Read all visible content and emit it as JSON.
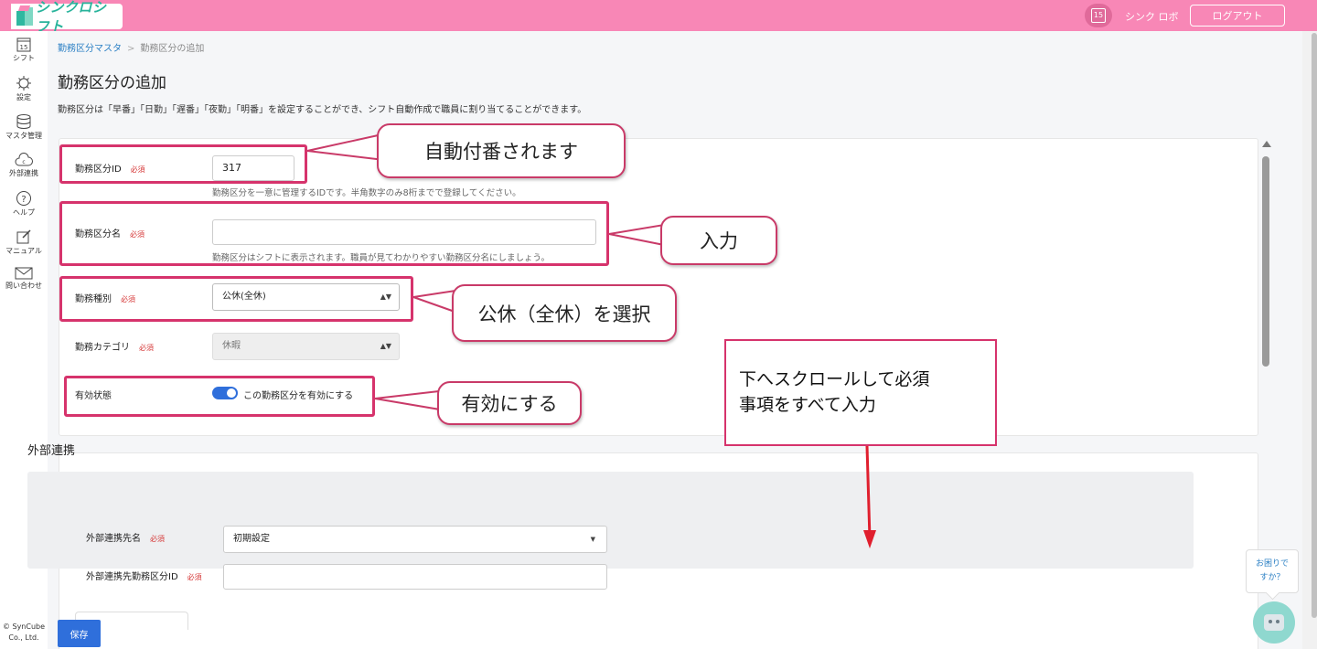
{
  "app": {
    "name": "シンクロシフト"
  },
  "header": {
    "calendar_day": "15",
    "user": "シンク ロボ",
    "logout": "ログアウト"
  },
  "sidebar": {
    "items": [
      {
        "label": "シフト",
        "icon": "calendar-icon"
      },
      {
        "label": "設定",
        "icon": "gear-icon"
      },
      {
        "label": "マスタ管理",
        "icon": "database-icon"
      },
      {
        "label": "外部連携",
        "icon": "cloud-icon"
      },
      {
        "label": "ヘルプ",
        "icon": "question-icon"
      },
      {
        "label": "マニュアル",
        "icon": "edit-icon"
      },
      {
        "label": "問い合わせ",
        "icon": "mail-icon"
      }
    ],
    "calendar_day": "15",
    "copyright_1": "© SynCube",
    "copyright_2": "Co., Ltd."
  },
  "breadcrumb": {
    "parent": "勤務区分マスタ",
    "separator": ">",
    "current": "勤務区分の追加"
  },
  "page": {
    "title": "勤務区分の追加",
    "description": "勤務区分は「早番」「日勤」「遅番」「夜勤」「明番」を設定することができ、シフト自動作成で職員に割り当てることができます。"
  },
  "form": {
    "required": "必須",
    "id": {
      "label": "勤務区分ID",
      "value": "317",
      "help": "勤務区分を一意に管理するIDです。半角数字のみ8桁までで登録してください。"
    },
    "name": {
      "label": "勤務区分名",
      "value": "",
      "help": "勤務区分はシフトに表示されます。職員が見てわかりやすい勤務区分名にしましょう。"
    },
    "type": {
      "label": "勤務種別",
      "value": "公休(全休)"
    },
    "category": {
      "label": "勤務カテゴリ",
      "value": "休暇"
    },
    "status": {
      "label": "有効状態",
      "toggle_label": "この勤務区分を有効にする",
      "enabled": true
    }
  },
  "external": {
    "title": "外部連携",
    "target": {
      "label": "外部連携先名",
      "value": "初期設定"
    },
    "code": {
      "label": "外部連携先勤務区分ID",
      "value": ""
    }
  },
  "save_button": "保存",
  "help_widget": {
    "line1": "お困りで",
    "line2": "すか？"
  },
  "annotations": {
    "auto_number": "自動付番されます",
    "input": "入力",
    "select_type": "公休（全休）を選択",
    "enable": "有効にする",
    "scroll_note_1": "下へスクロールして必須",
    "scroll_note_2": "事項をすべて入力"
  },
  "colors": {
    "header": "#f887b6",
    "accent": "#2f6fdb",
    "highlight": "#d6336c",
    "required": "#d63939",
    "logo": "#28b39b"
  }
}
